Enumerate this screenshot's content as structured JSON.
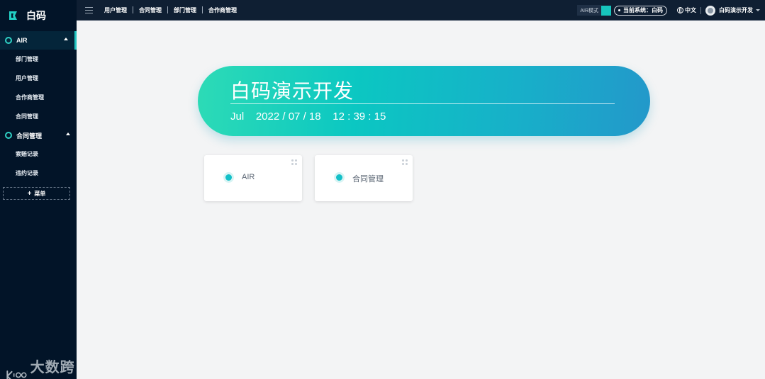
{
  "app": {
    "title": "白码"
  },
  "sidebar": {
    "groups": [
      {
        "label": "AIR",
        "items": [
          "部门管理",
          "用户管理",
          "合作商管理",
          "合同管理"
        ]
      },
      {
        "label": "合同管理",
        "items": [
          "索赔记录",
          "违约记录"
        ]
      }
    ],
    "add_menu_label": "菜单",
    "add_menu_icon": "+"
  },
  "topbar": {
    "nav": [
      "用户管理",
      "合同管理",
      "部门管理",
      "合作商管理"
    ],
    "mode_label": "AIR模式",
    "system_label": "当前系统：白码",
    "language": "中文",
    "user_name": "白码演示开发"
  },
  "banner": {
    "title": "白码演示开发",
    "datetime": "Jul    2022 / 07 / 18    12 : 39 : 15"
  },
  "cards": [
    {
      "label": "AIR"
    },
    {
      "label": "合同管理"
    }
  ],
  "watermark": {
    "text": "大数跨境"
  },
  "colors": {
    "sidebar_bg": "#021428",
    "accent": "#20c4c0",
    "banner_start": "#2ddbb6",
    "banner_end": "#2398ca"
  }
}
